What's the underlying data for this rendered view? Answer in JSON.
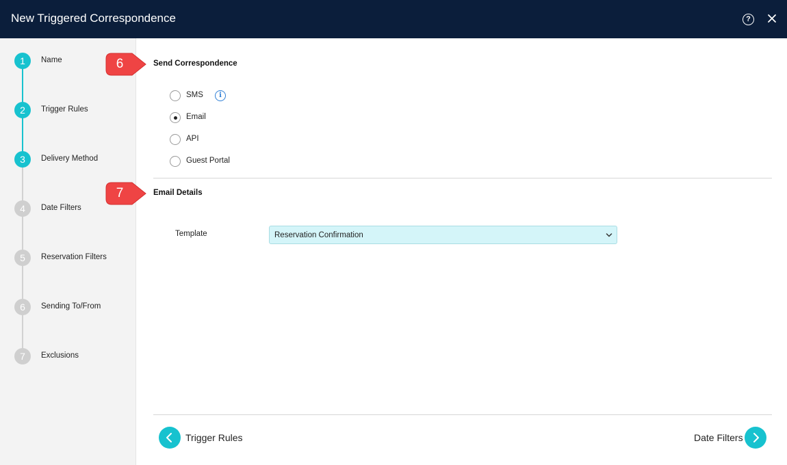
{
  "window": {
    "title": "New Triggered Correspondence",
    "help_glyph": "?",
    "close_icon": "close-icon"
  },
  "steps": [
    {
      "num": "1",
      "label": "Name",
      "state": "complete"
    },
    {
      "num": "2",
      "label": "Trigger Rules",
      "state": "complete"
    },
    {
      "num": "3",
      "label": "Delivery Method",
      "state": "current"
    },
    {
      "num": "4",
      "label": "Date Filters",
      "state": "pending"
    },
    {
      "num": "5",
      "label": "Reservation Filters",
      "state": "pending"
    },
    {
      "num": "6",
      "label": "Sending To/From",
      "state": "pending"
    },
    {
      "num": "7",
      "label": "Exclusions",
      "state": "pending"
    }
  ],
  "callouts": {
    "first": "6",
    "second": "7"
  },
  "send_correspondence": {
    "title": "Send Correspondence",
    "options": [
      {
        "label": "SMS",
        "selected": false
      },
      {
        "label": "Email",
        "selected": true
      },
      {
        "label": "API",
        "selected": false
      },
      {
        "label": "Guest Portal",
        "selected": false
      }
    ],
    "info_glyph": "i"
  },
  "email_details": {
    "title": "Email Details",
    "template_label": "Template",
    "template_value": "Reservation Confirmation"
  },
  "footer": {
    "back_label": "Trigger Rules",
    "next_label": "Date Filters"
  },
  "colors": {
    "header_bg": "#0b1e3b",
    "accent": "#17c2cf",
    "inactive_step": "#cfcfcf",
    "callout": "#ef4444",
    "select_bg": "#d4f5f9",
    "info_blue": "#2f7fd6"
  }
}
